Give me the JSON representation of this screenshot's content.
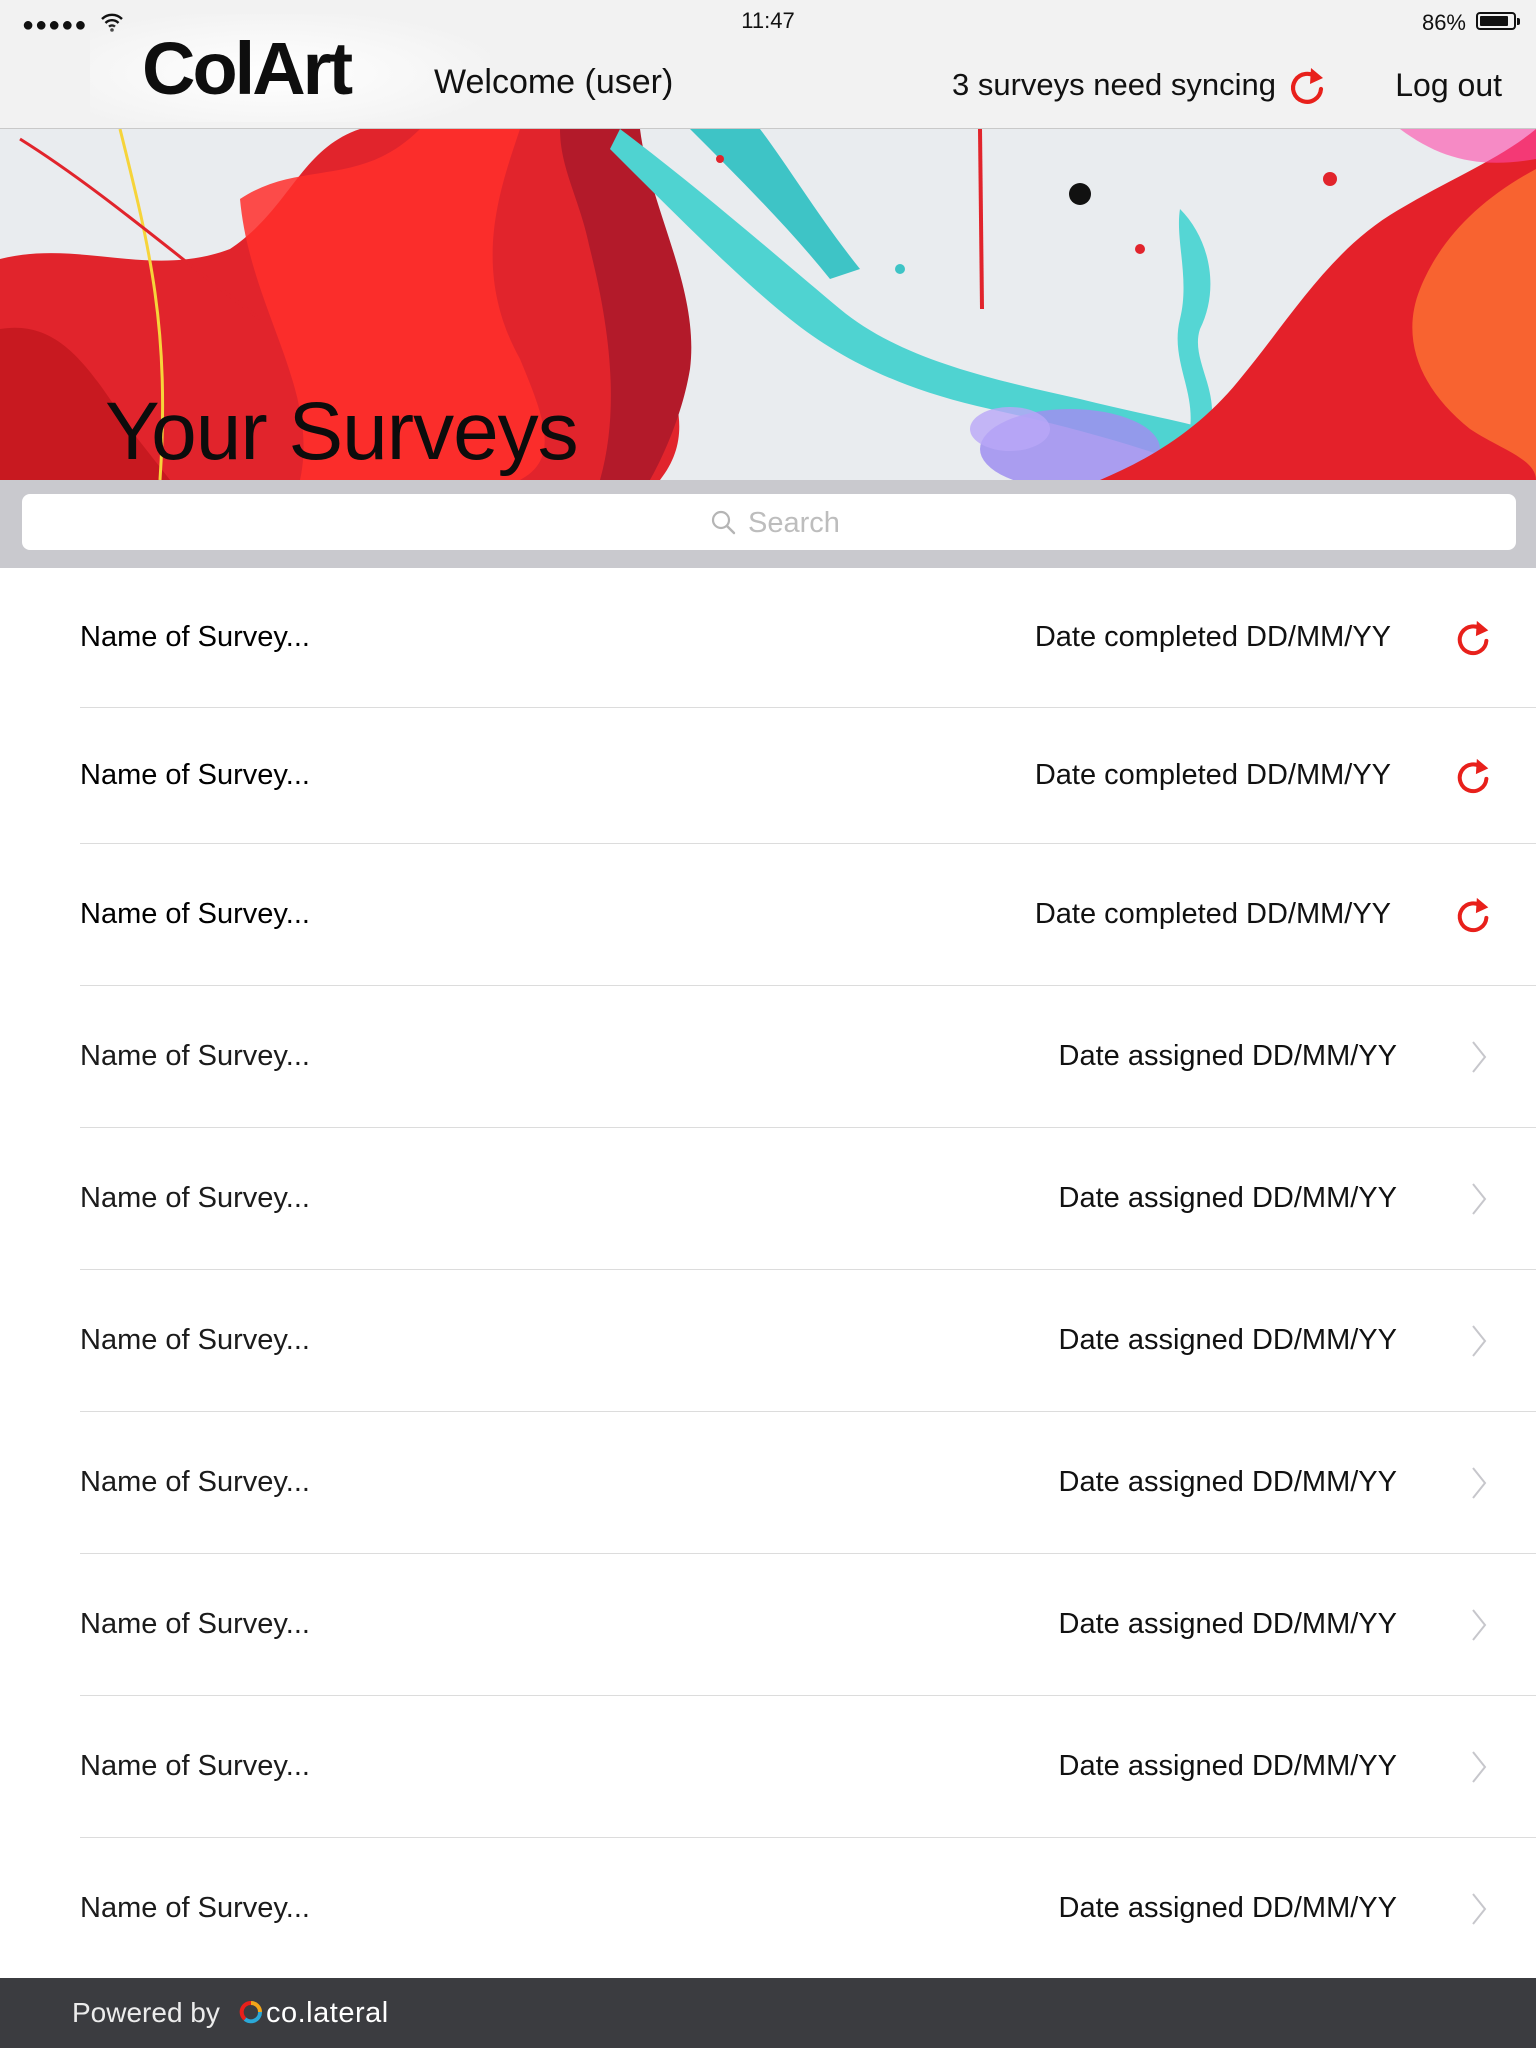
{
  "status_bar": {
    "signal": "●●●●●",
    "time": "11:47",
    "battery": "86%",
    "battery_level": 0.86
  },
  "header": {
    "logo": "ColArt",
    "welcome": "Welcome (user)",
    "sync_status": "3 surveys need syncing",
    "sync_icon": "sync-icon",
    "logout_label": "Log out"
  },
  "banner": {
    "title": "Your Surveys"
  },
  "search": {
    "placeholder": "Search",
    "icon": "search-icon"
  },
  "surveys": [
    {
      "name": "Name of Survey...",
      "date": "Date completed DD/MM/YY",
      "status": "completed",
      "icon": "sync-icon"
    },
    {
      "name": "Name of Survey...",
      "date": "Date completed DD/MM/YY",
      "status": "completed",
      "icon": "sync-icon"
    },
    {
      "name": "Name of Survey...",
      "date": "Date completed DD/MM/YY",
      "status": "completed",
      "icon": "sync-icon"
    },
    {
      "name": "Name of Survey...",
      "date": "Date assigned DD/MM/YY",
      "status": "assigned",
      "icon": "chevron-right-icon"
    },
    {
      "name": "Name of Survey...",
      "date": "Date assigned DD/MM/YY",
      "status": "assigned",
      "icon": "chevron-right-icon"
    },
    {
      "name": "Name of Survey...",
      "date": "Date assigned DD/MM/YY",
      "status": "assigned",
      "icon": "chevron-right-icon"
    },
    {
      "name": "Name of Survey...",
      "date": "Date assigned DD/MM/YY",
      "status": "assigned",
      "icon": "chevron-right-icon"
    },
    {
      "name": "Name of Survey...",
      "date": "Date assigned DD/MM/YY",
      "status": "assigned",
      "icon": "chevron-right-icon"
    },
    {
      "name": "Name of Survey...",
      "date": "Date assigned DD/MM/YY",
      "status": "assigned",
      "icon": "chevron-right-icon"
    },
    {
      "name": "Name of Survey...",
      "date": "Date assigned DD/MM/YY",
      "status": "assigned",
      "icon": "chevron-right-icon"
    }
  ],
  "footer": {
    "powered_by": "Powered by",
    "brand": "co.lateral"
  },
  "colors": {
    "accent_sync": "#e8201b",
    "header_bg": "#f2f2f2",
    "footer_bg": "#3b3c40",
    "search_bar_bg": "#c9c9ce",
    "chevron": "#c7c7cc"
  }
}
